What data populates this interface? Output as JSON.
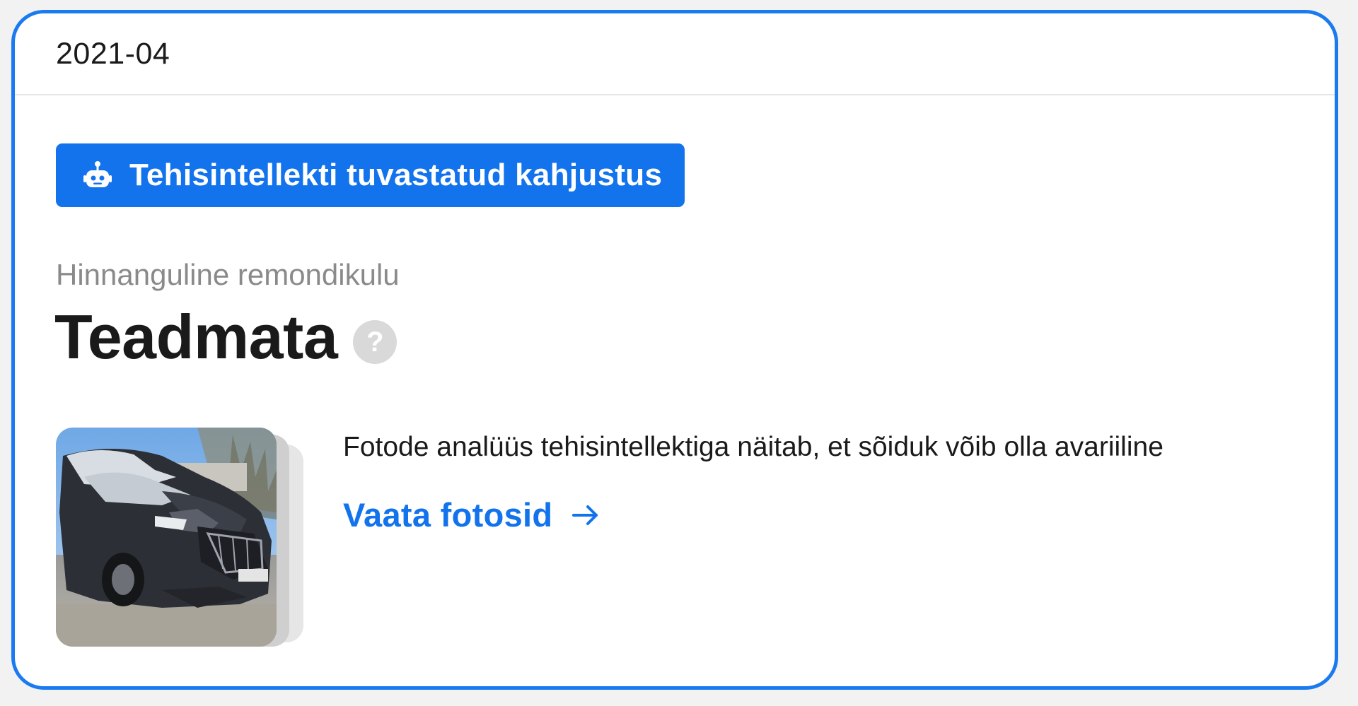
{
  "card": {
    "date": "2021-04",
    "ai_badge": {
      "icon": "robot-icon",
      "label": "Tehisintellekti tuvastatud kahjustus"
    },
    "repair_cost": {
      "label": "Hinnanguline remondikulu",
      "value": "Teadmata",
      "help_icon": "question-mark-icon",
      "help_glyph": "?"
    },
    "analysis": {
      "text": "Fotode analüüs tehisintellektiga näitab, et sõiduk võib olla avariiline",
      "link_label": "Vaata fotosid",
      "link_icon": "arrow-right-icon"
    }
  },
  "colors": {
    "accent": "#1273ec",
    "border": "#1a7af0",
    "muted_text": "#8a8a8a",
    "help_icon_bg": "#d9d9d9"
  }
}
